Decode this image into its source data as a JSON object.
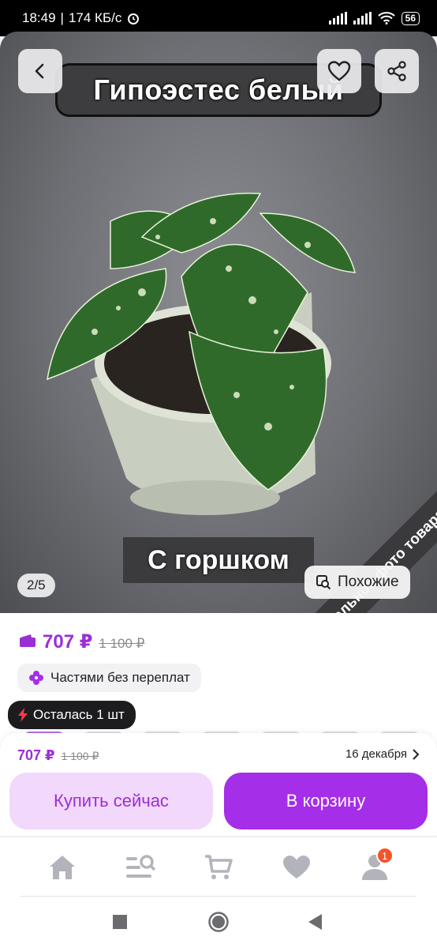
{
  "status": {
    "time": "18:49",
    "speed": "174 КБ/с",
    "battery": "56"
  },
  "product": {
    "photo_title": "Гипоэстес белый",
    "photo_label": "С горшком",
    "photo_counter": "2/5",
    "similar_label": "Похожие",
    "ribbon_text": "Реальное фото товара"
  },
  "price": {
    "current": "707 ₽",
    "old": "1 100 ₽"
  },
  "installments": {
    "label": "Частями без переплат"
  },
  "stock": {
    "label": "Осталась 1 шт"
  },
  "buy_panel": {
    "price": "707 ₽",
    "old_price": "1 100 ₽",
    "delivery_date": "16 декабря",
    "buy_now_label": "Купить сейчас",
    "cart_label": "В корзину"
  },
  "bottom_nav": {
    "profile_badge": "1"
  },
  "colors": {
    "accent": "#a52ee8",
    "price": "#9b2fd6",
    "badge": "#f2542a"
  }
}
